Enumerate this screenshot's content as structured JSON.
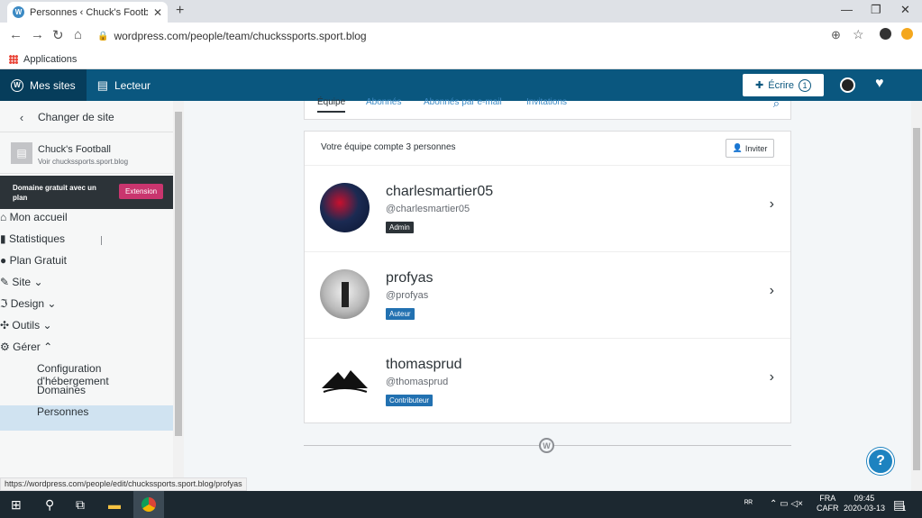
{
  "browser": {
    "tab_title": "Personnes ‹ Chuck's Football — V",
    "url": "wordpress.com/people/team/chuckssports.sport.blog",
    "bookmarks_label": "Applications",
    "status_url": "https://wordpress.com/people/edit/chuckssports.sport.blog/profyas"
  },
  "masterbar": {
    "my_sites": "Mes sites",
    "reader": "Lecteur",
    "write": "Écrire",
    "write_count": "1"
  },
  "sidebar": {
    "switch_site": "Changer de site",
    "site_name": "Chuck's Football",
    "site_link": "Voir chuckssports.sport.blog",
    "promo_text": "Domaine gratuit avec un plan",
    "promo_button": "Extension",
    "items": [
      {
        "label": "Mon accueil",
        "icon": "home-icon"
      },
      {
        "label": "Statistiques",
        "icon": "stats-icon"
      },
      {
        "label": "Plan",
        "icon": "plan-icon",
        "right": "Gratuit"
      },
      {
        "label": "Site",
        "icon": "pencil-icon"
      },
      {
        "label": "Design",
        "icon": "design-icon"
      },
      {
        "label": "Outils",
        "icon": "tools-icon"
      },
      {
        "label": "Gérer",
        "icon": "gear-icon"
      }
    ],
    "sub_items": [
      "Configuration d'hébergement",
      "Domaines",
      "Personnes"
    ]
  },
  "people": {
    "tabs": [
      "Équipe",
      "Abonnés",
      "Abonnés par e-mail",
      "Invitations"
    ],
    "count_text": "Votre équipe compte 3 personnes",
    "invite_label": "Inviter",
    "members": [
      {
        "name": "charlesmartier05",
        "handle": "@charlesmartier05",
        "role": "Admin",
        "role_color": "#2c3338"
      },
      {
        "name": "profyas",
        "handle": "@profyas",
        "role": "Auteur",
        "role_color": "#2271b1"
      },
      {
        "name": "thomasprud",
        "handle": "@thomasprud",
        "role": "Contributeur",
        "role_color": "#2271b1"
      }
    ]
  },
  "taskbar": {
    "lang": "FRA",
    "lang2": "CAFR",
    "time": "09:45",
    "date": "2020-03-13",
    "notif_count": "1"
  },
  "colors": {
    "masterbar": "#0a577f",
    "promo_button": "#c9356e",
    "help": "#1e83c0"
  }
}
